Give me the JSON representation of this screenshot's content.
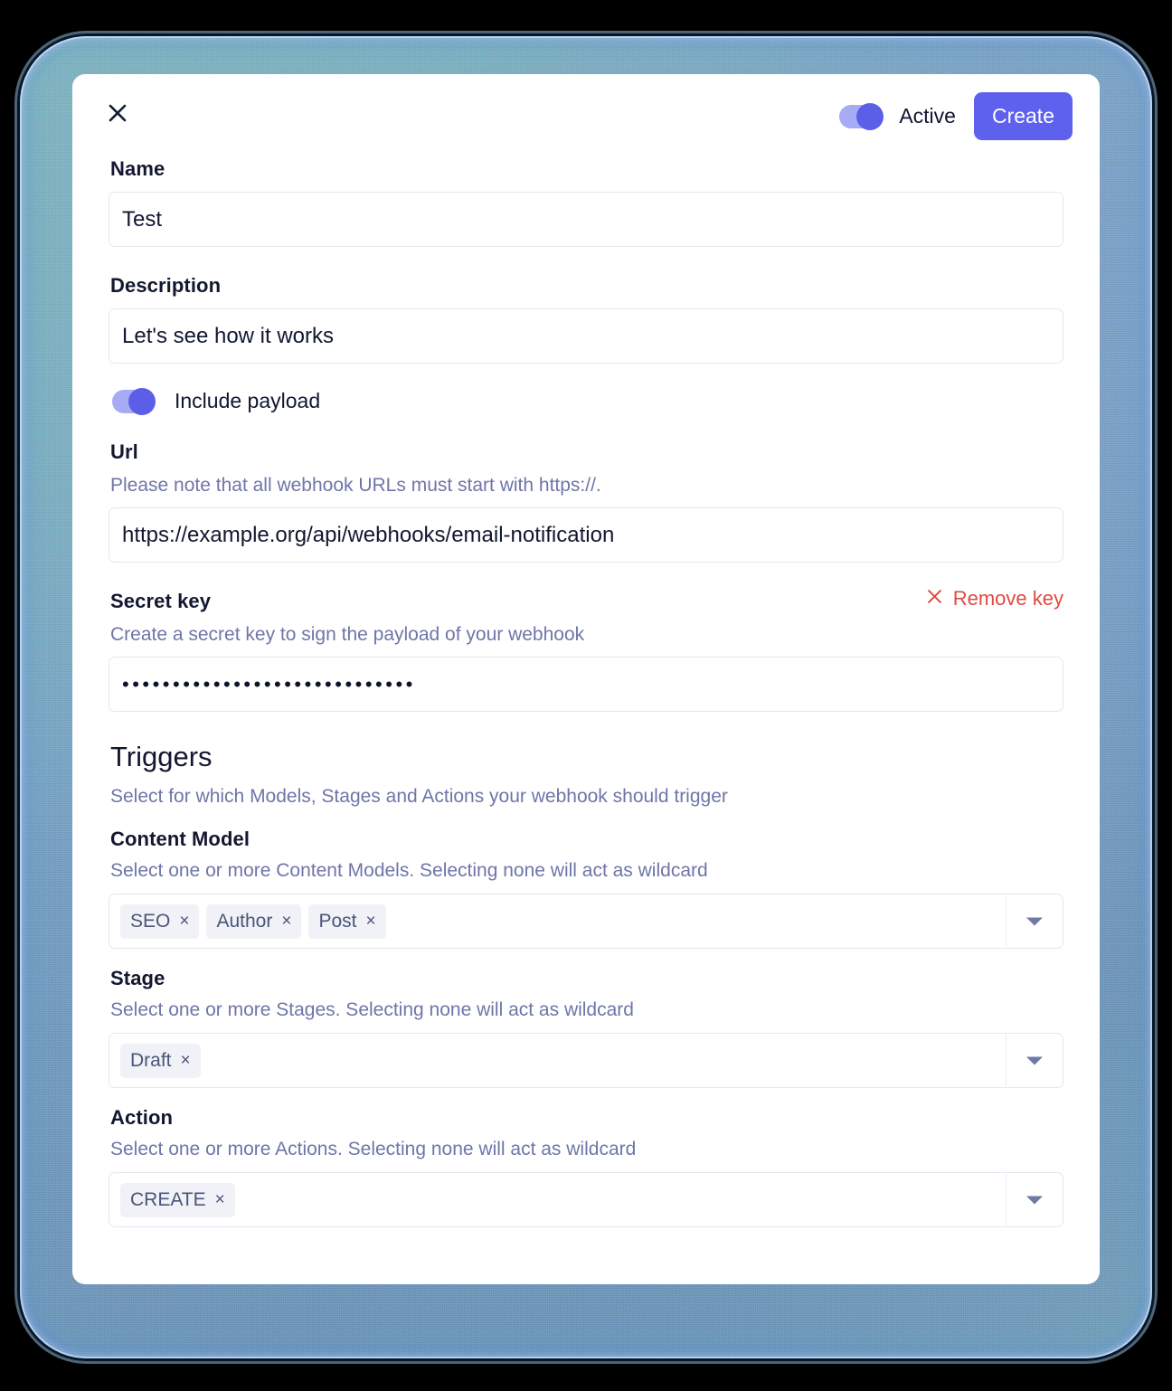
{
  "header": {
    "close_icon": "close-icon",
    "toggle_active_label": "Active",
    "toggle_active_state": "on",
    "create_label": "Create",
    "accent_color": "#5d61ed"
  },
  "form": {
    "name": {
      "label": "Name",
      "value": "Test"
    },
    "description": {
      "label": "Description",
      "value": "Let's see how it works"
    },
    "include_payload": {
      "label": "Include payload",
      "state": "on"
    },
    "url": {
      "label": "Url",
      "hint": "Please note that all webhook URLs must start with https://.",
      "value": "https://example.org/api/webhooks/email-notification"
    },
    "secret_key": {
      "label": "Secret key",
      "hint": "Create a secret key to sign the payload of your webhook",
      "remove_label": "Remove key",
      "remove_icon": "close-icon",
      "remove_color": "#df4a44",
      "masked_value": "•••••••••••••••••••••••••••••"
    }
  },
  "triggers": {
    "title": "Triggers",
    "subtitle": "Select for which Models, Stages and Actions your webhook should trigger",
    "groups": [
      {
        "label": "Content Model",
        "hint": "Select one or more Content Models. Selecting none will act as wildcard",
        "chips": [
          "SEO",
          "Author",
          "Post"
        ],
        "chip_remove_icon": "×",
        "caret_icon": "chevron-down-icon"
      },
      {
        "label": "Stage",
        "hint": "Select one or more Stages. Selecting none will act as wildcard",
        "chips": [
          "Draft"
        ],
        "chip_remove_icon": "×",
        "caret_icon": "chevron-down-icon"
      },
      {
        "label": "Action",
        "hint": "Select one or more Actions. Selecting none will act as wildcard",
        "chips": [
          "CREATE"
        ],
        "chip_remove_icon": "×",
        "caret_icon": "chevron-down-icon"
      }
    ]
  }
}
